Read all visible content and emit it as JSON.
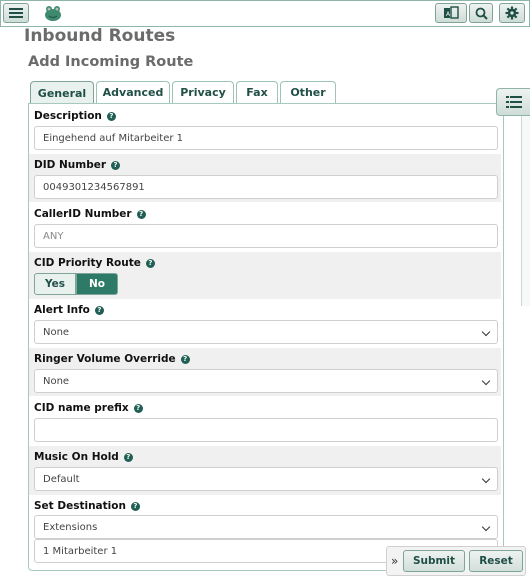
{
  "header": {
    "menu_icon": "hamburger-menu-icon",
    "logo_icon": "frog-logo-icon",
    "language_icon": "language-book-icon",
    "search_icon": "search-icon",
    "settings_icon": "gear-icon"
  },
  "page": {
    "title": "Inbound Routes",
    "section": "Add Incoming Route"
  },
  "tabs": [
    {
      "label": "General",
      "active": true
    },
    {
      "label": "Advanced",
      "active": false
    },
    {
      "label": "Privacy",
      "active": false
    },
    {
      "label": "Fax",
      "active": false
    },
    {
      "label": "Other",
      "active": false
    }
  ],
  "form": {
    "description": {
      "label": "Description",
      "value": "Eingehend auf Mitarbeiter 1"
    },
    "did_number": {
      "label": "DID Number",
      "value": "0049301234567891"
    },
    "callerid_number": {
      "label": "CallerID Number",
      "placeholder": "ANY"
    },
    "cid_priority": {
      "label": "CID Priority Route",
      "yes": "Yes",
      "no": "No",
      "selected": "No"
    },
    "alert_info": {
      "label": "Alert Info",
      "value": "None"
    },
    "ringer_volume": {
      "label": "Ringer Volume Override",
      "value": "None"
    },
    "cid_prefix": {
      "label": "CID name prefix",
      "value": ""
    },
    "music_on_hold": {
      "label": "Music On Hold",
      "value": "Default"
    },
    "set_destination": {
      "label": "Set Destination",
      "type_value": "Extensions",
      "target_value": "1 Mitarbeiter 1"
    },
    "help_glyph": "?"
  },
  "actions": {
    "collapse_glyph": "»",
    "submit": "Submit",
    "reset": "Reset"
  },
  "colors": {
    "accent": "#2e7a68",
    "tab_text": "#1f4f45",
    "border": "#a6c9bd"
  }
}
